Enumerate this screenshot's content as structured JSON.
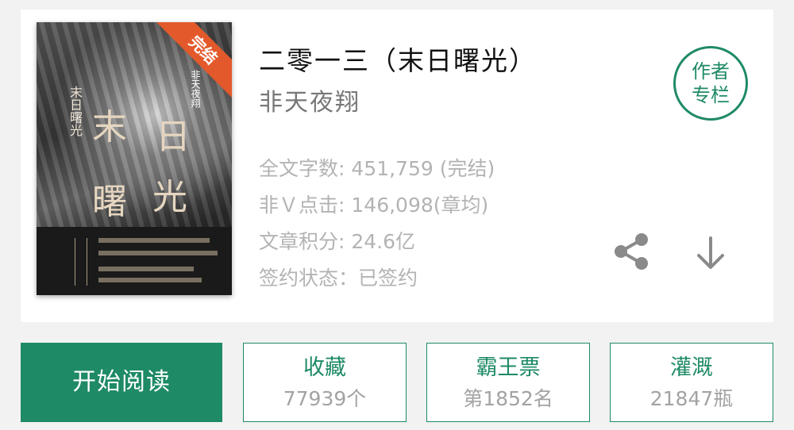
{
  "book": {
    "title": "二零一三（末日曙光）",
    "author": "非天夜翔",
    "cover": {
      "ribbon": "完结",
      "chars": [
        "末",
        "日",
        "曙",
        "光"
      ],
      "vertical_title": "末日曙光",
      "author_tag": "非天夜翔"
    }
  },
  "author_column": {
    "line1": "作者",
    "line2": "专栏"
  },
  "stats": [
    {
      "label": "全文字数:",
      "value": " 451,759 (完结)"
    },
    {
      "label": "非Ｖ点击:",
      "value": " 146,098(章均)"
    },
    {
      "label": "文章积分:",
      "value": " 24.6亿"
    },
    {
      "label": "签约状态：",
      "value": "已签约"
    }
  ],
  "actions": {
    "start_read": "开始阅读",
    "favorite": {
      "label": "收藏",
      "count": "77939个"
    },
    "ticket": {
      "label": "霸王票",
      "rank": "第1852名"
    },
    "water": {
      "label": "灌溉",
      "count": "21847瓶"
    }
  },
  "icons": {
    "share": "share-icon",
    "download": "download-arrow-icon"
  },
  "colors": {
    "accent": "#1e8a66",
    "ribbon": "#e3592b",
    "muted_text": "#b3b3b3"
  }
}
